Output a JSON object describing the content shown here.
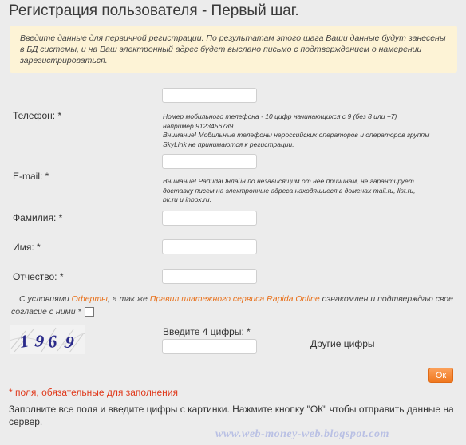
{
  "page": {
    "title": "Регистрация пользователя - Первый шаг."
  },
  "info": {
    "text": "Введите данные для первичной регистрации. По результатам этого шага Ваши данные будут занесены в БД системы, и на Ваш электронный адрес будет выслано письмо с подтверждением о намерении зарегистрироваться."
  },
  "form": {
    "phone": {
      "label": "Телефон: *",
      "value": "",
      "hint_line1": "Номер мобильного телефона - 10 цифр начинающихся с 9 (без 8 или +7)",
      "hint_line2": "например 9123456789",
      "hint_line3": "Внимание! Мобильные телефоны нероссийских операторов и операторов группы",
      "hint_line4": "SkyLink не принимаются к регистрации."
    },
    "email": {
      "label": "E-mail: *",
      "value": "",
      "hint_line1": "Внимание! РапидаОнлайн по независящим от нее причинам, не гарантирует",
      "hint_line2": "доставку писем на электронные адреса находящиеся в доменах mail.ru, list.ru,",
      "hint_line3": "bk.ru и inbox.ru."
    },
    "last_name": {
      "label": "Фамилия: *",
      "value": ""
    },
    "first_name": {
      "label": "Имя: *",
      "value": ""
    },
    "patronymic": {
      "label": "Отчество: *",
      "value": ""
    },
    "consent": {
      "prefix": "С условиями",
      "oferta_link": "Оферты",
      "middle": ", а так же",
      "rules_link": "Правил платежного сервиса Rapida Online",
      "suffix": "ознакомлен и подтверждаю свое согласие с ними *",
      "checked": false
    },
    "captcha": {
      "label": "Введите 4 цифры: *",
      "value": "",
      "image_digits": "1969",
      "refresh_label": "Другие цифры"
    },
    "ok_label": "Ок",
    "required_note": "* поля, обязательные для заполнения",
    "footer": "Заполните все поля и введите цифры с картинки. Нажмите кнопку \"ОК\" чтобы отправить данные на сервер."
  },
  "watermark": "www.web-money-web.blogspot.com",
  "colors": {
    "accent": "#e8701a",
    "required": "#e03a1c",
    "info_bg": "#fdf3d6",
    "page_bg": "#ececec"
  }
}
